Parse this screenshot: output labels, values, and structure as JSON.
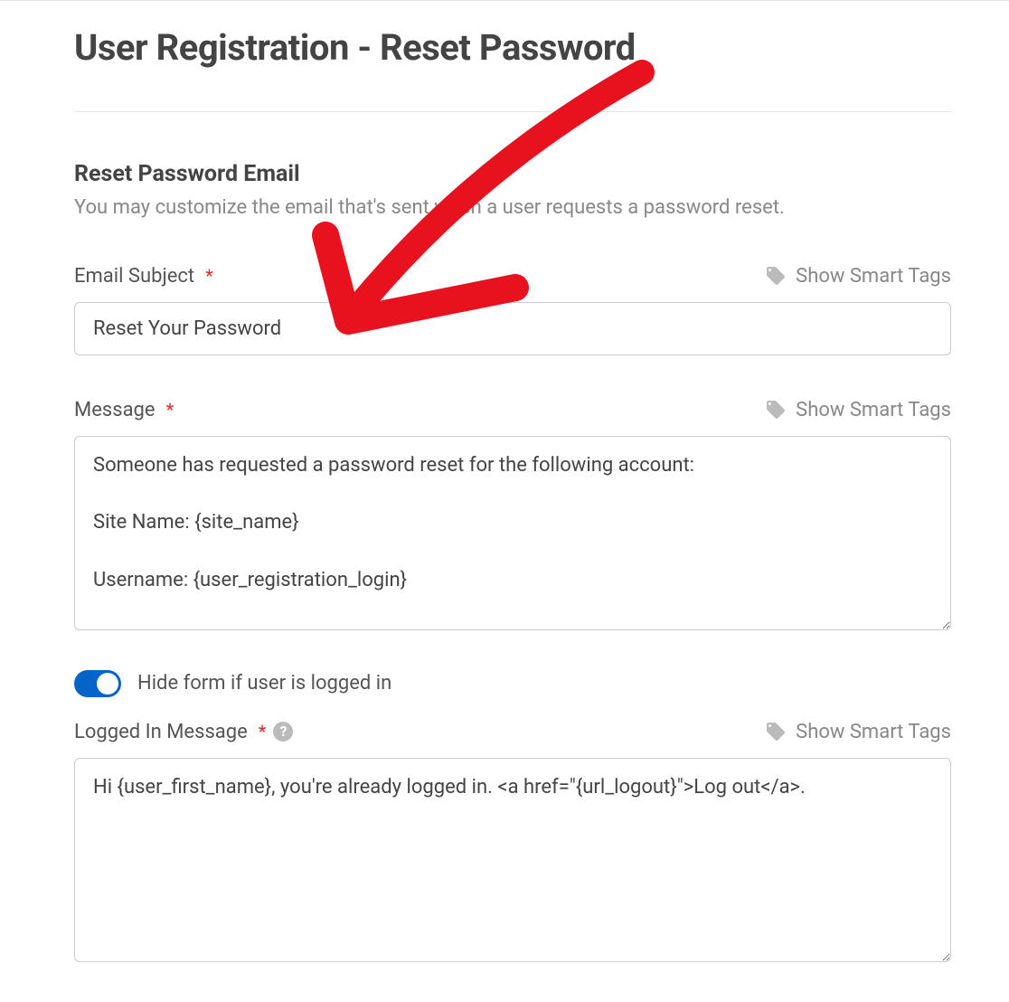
{
  "page_title": "User Registration - Reset Password",
  "section": {
    "title": "Reset Password Email",
    "description": "You may customize the email that's sent when a user requests a password reset."
  },
  "smart_tags_label": "Show Smart Tags",
  "fields": {
    "email_subject": {
      "label": "Email Subject",
      "value": "Reset Your Password"
    },
    "message": {
      "label": "Message",
      "value": "Someone has requested a password reset for the following account:\n\nSite Name: {site_name}\n\nUsername: {user_registration_login}"
    },
    "hide_toggle": {
      "label": "Hide form if user is logged in",
      "value": true
    },
    "logged_in_message": {
      "label": "Logged In Message",
      "value": "Hi {user_first_name}, you're already logged in. <a href=\"{url_logout}\">Log out</a>."
    }
  }
}
